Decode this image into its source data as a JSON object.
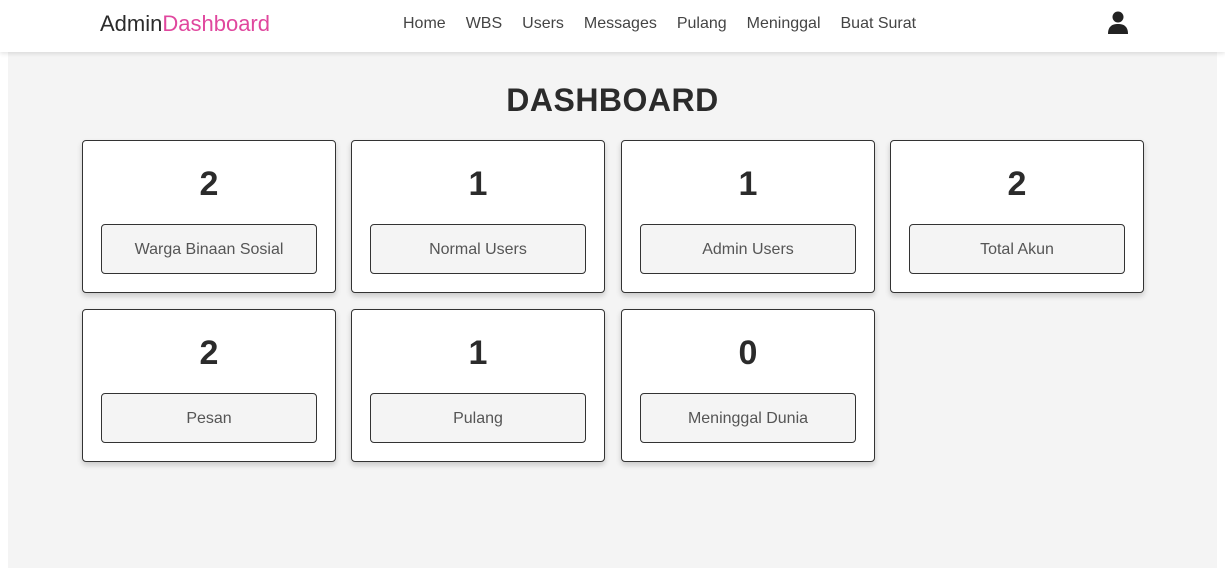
{
  "navbar": {
    "logo_prefix": "Admin",
    "logo_accent": "Dashboard",
    "links": [
      "Home",
      "WBS",
      "Users",
      "Messages",
      "Pulang",
      "Meninggal",
      "Buat Surat"
    ],
    "user_icon": "user-icon",
    "accent_color": "#e0479e"
  },
  "main": {
    "title": "DASHBOARD",
    "cards": [
      {
        "value": "2",
        "label": "Warga Binaan Sosial"
      },
      {
        "value": "1",
        "label": "Normal Users"
      },
      {
        "value": "1",
        "label": "Admin Users"
      },
      {
        "value": "2",
        "label": "Total Akun"
      },
      {
        "value": "2",
        "label": "Pesan"
      },
      {
        "value": "1",
        "label": "Pulang"
      },
      {
        "value": "0",
        "label": "Meninggal Dunia"
      }
    ]
  }
}
